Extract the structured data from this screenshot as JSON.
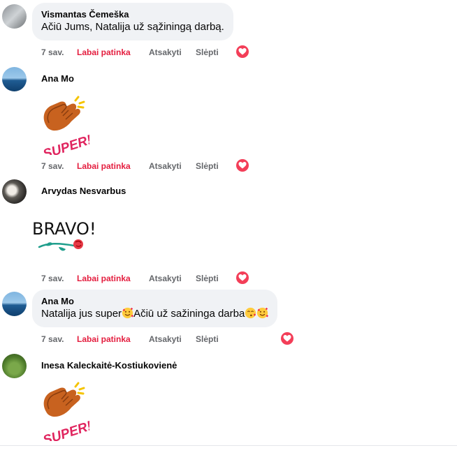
{
  "comments": [
    {
      "author": "Vismantas Čemeška",
      "text": "Ačiū Jums, Natalija už sąžiningą darbą.",
      "actions": {
        "time": "7 sav.",
        "like": "Labai patinka",
        "reply": "Atsakyti",
        "hide": "Slėpti"
      },
      "reaction_count": "1"
    },
    {
      "author": "Ana Mo",
      "sticker": "SUPER!",
      "actions": {
        "time": "7 sav.",
        "like": "Labai patinka",
        "reply": "Atsakyti",
        "hide": "Slėpti"
      },
      "reaction_count": "1"
    },
    {
      "author": "Arvydas Nesvarbus",
      "sticker": "BRAVO!",
      "actions": {
        "time": "7 sav.",
        "like": "Labai patinka",
        "reply": "Atsakyti",
        "hide": "Slėpti"
      },
      "reaction_count": "1"
    },
    {
      "author": "Ana Mo",
      "text_part1": "Natalija jus super",
      "text_part2": "Ačiū už sažininga darba",
      "actions": {
        "time": "7 sav.",
        "like": "Labai patinka",
        "reply": "Atsakyti",
        "hide": "Slėpti"
      },
      "reaction_count": "1"
    },
    {
      "author": "Inesa Kaleckaitė-Kostiukovienė",
      "sticker": "SUPER!"
    }
  ],
  "colors": {
    "like_active": "#e41e3f",
    "heart": "#f33e58",
    "bubble": "#f0f2f5",
    "muted": "#65676b"
  },
  "icons": {
    "reaction": "heart-icon",
    "emoji_hearts": "smiling-face-with-hearts-emoji",
    "emoji_kiss": "face-blowing-kiss-emoji"
  }
}
